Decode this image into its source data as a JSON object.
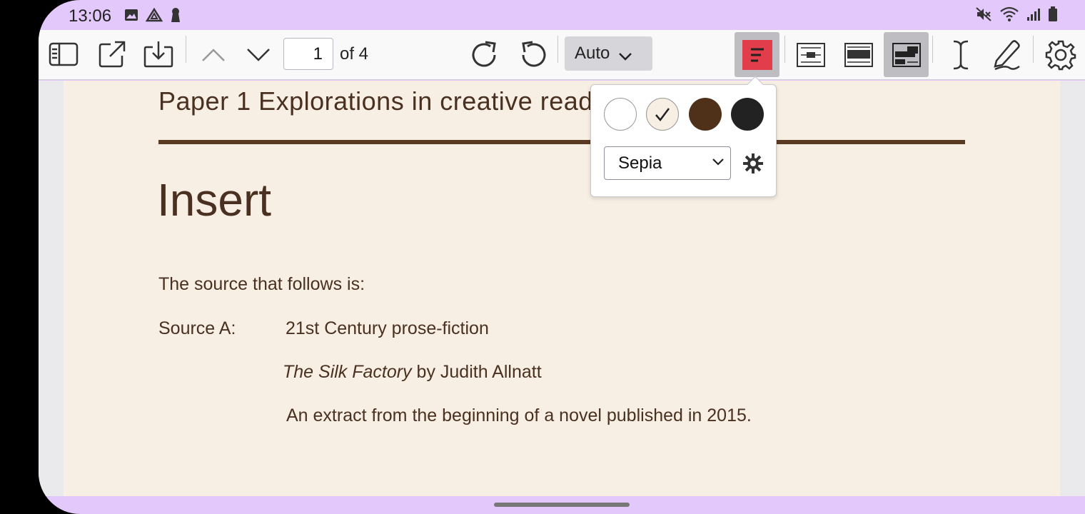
{
  "status_bar": {
    "time": "13:06",
    "left_icons": [
      "gallery-icon",
      "drive-icon",
      "keyhole-icon"
    ],
    "right_icons": [
      "mute-icon",
      "wifi-icon",
      "signal-icon",
      "battery-icon"
    ]
  },
  "toolbar": {
    "page_number": "1",
    "page_of": "of 4",
    "zoom": "Auto",
    "icons": {
      "sidebar": "sidebar-toggle-icon",
      "open": "open-external-icon",
      "download": "download-icon",
      "prev": "chevron-up-icon",
      "next": "chevron-down-icon",
      "rotate_cw": "rotate-clockwise-icon",
      "rotate_ccw": "rotate-counterclockwise-icon",
      "color_theme": "color-theme-icon",
      "fit_center": "fit-center-icon",
      "fit_width": "fit-width-icon",
      "page_layout": "page-layout-icon",
      "text_select": "text-cursor-icon",
      "draw": "pencil-icon",
      "settings": "gear-icon"
    },
    "accent_color": "#e23d4a"
  },
  "document": {
    "paper_heading": "Paper 1  Explorations in creative read",
    "insert_title": "Insert",
    "intro": "The source that follows is:",
    "source_label": "Source A:",
    "source_type": "21st Century prose-fiction",
    "book_title": "The Silk Factory",
    "book_author": " by Judith Allnatt",
    "extract_note": "An extract from the beginning of a novel published in 2015.",
    "page_color": "#f7efe3",
    "text_color": "#4a3020"
  },
  "theme_popup": {
    "swatches": [
      {
        "name": "white",
        "color": "#ffffff",
        "selected": false
      },
      {
        "name": "sepia",
        "color": "#f7efe3",
        "selected": true
      },
      {
        "name": "brown",
        "color": "#4e3118",
        "selected": false
      },
      {
        "name": "dark",
        "color": "#222222",
        "selected": false
      }
    ],
    "selected_theme": "Sepia",
    "options": [
      "Sepia"
    ]
  }
}
